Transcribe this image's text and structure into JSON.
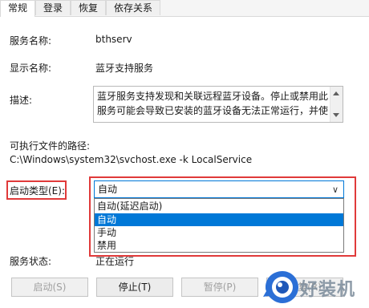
{
  "tabs": [
    {
      "label": "常规",
      "active": true
    },
    {
      "label": "登录",
      "active": false
    },
    {
      "label": "恢复",
      "active": false
    },
    {
      "label": "依存关系",
      "active": false
    }
  ],
  "service_name": {
    "label": "服务名称:",
    "value": "bthserv"
  },
  "display_name": {
    "label": "显示名称:",
    "value": "蓝牙支持服务"
  },
  "description": {
    "label": "描述:",
    "text_line1": "蓝牙服务支持发现和关联远程蓝牙设备。停止或禁用此",
    "text_line2": "服务可能会导致已安装的蓝牙设备无法正常运行，并使"
  },
  "exe_path": {
    "label": "可执行文件的路径:",
    "value": "C:\\Windows\\system32\\svchost.exe -k LocalService"
  },
  "startup_type": {
    "label": "启动类型(E):",
    "selected": "自动",
    "options": [
      "自动(延迟启动)",
      "自动",
      "手动",
      "禁用"
    ],
    "highlighted_option": "自动"
  },
  "service_status": {
    "label": "服务状态:",
    "value": "正在运行"
  },
  "buttons": {
    "start": "启动(S)",
    "stop": "停止(T)",
    "pause": "暂停(P)",
    "resume": "恢复(R)"
  },
  "watermark": {
    "text": "好装机"
  },
  "colors": {
    "highlight": "#e03a3a",
    "selection": "#0078d7"
  }
}
